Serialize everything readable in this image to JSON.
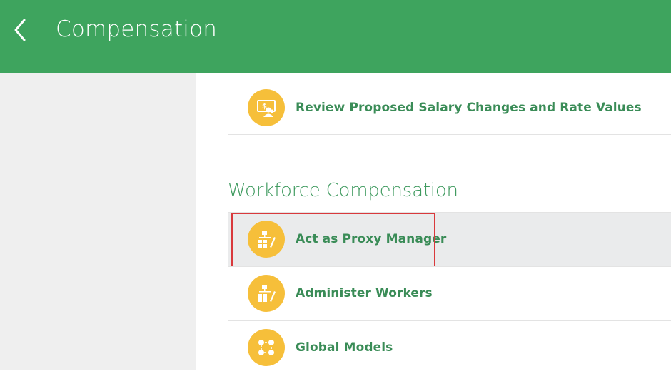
{
  "header": {
    "title": "Compensation",
    "back_icon": "chevron-left-icon",
    "background_color": "#3ea45e"
  },
  "main": {
    "top_item": {
      "label": "Review Proposed Salary Changes and Rate Values",
      "icon": "salary-review-icon"
    },
    "section": {
      "title": "Workforce Compensation",
      "items": [
        {
          "label": "Act as Proxy Manager",
          "icon": "org-chart-edit-icon",
          "selected": true,
          "highlighted": true
        },
        {
          "label": "Administer Workers",
          "icon": "org-chart-edit-icon"
        },
        {
          "label": "Global Models",
          "icon": "model-nodes-icon"
        }
      ]
    }
  },
  "colors": {
    "accent_green": "#3ea45e",
    "label_green": "#3a8c57",
    "icon_yellow": "#f6bf3a",
    "highlight_red": "#d9393c",
    "sidebar_gray": "#efefef"
  }
}
